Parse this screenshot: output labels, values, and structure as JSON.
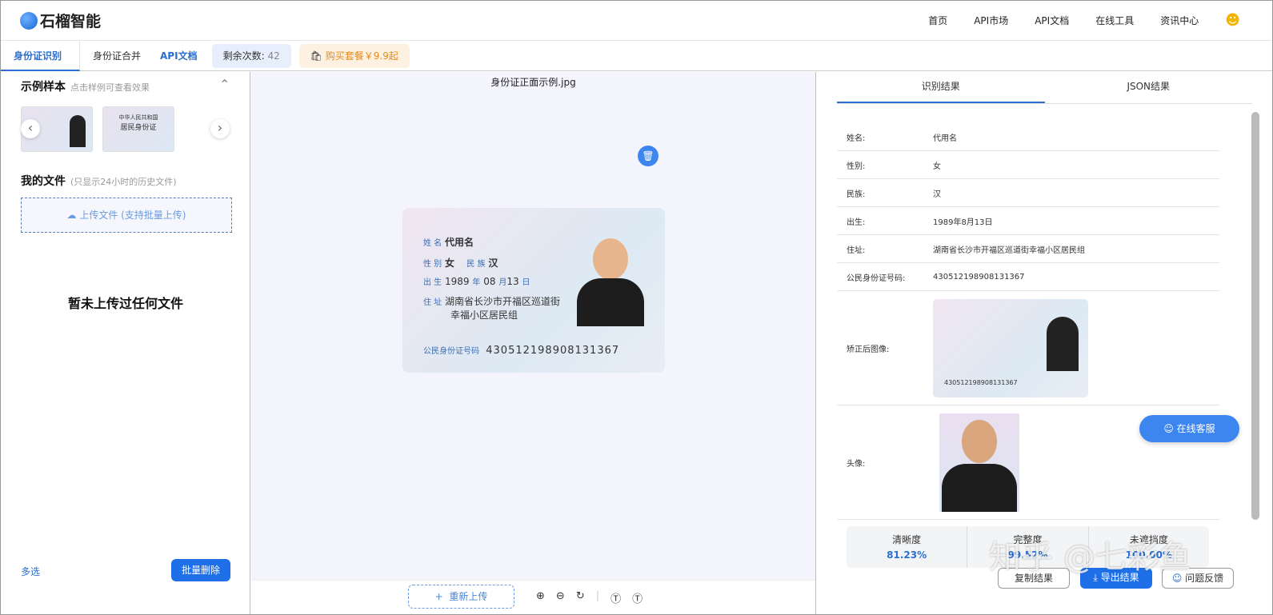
{
  "brand": "石榴智能",
  "nav": [
    "首页",
    "API市场",
    "API文档",
    "在线工具",
    "资讯中心"
  ],
  "tabs": {
    "active": "身份证识别",
    "merge": "身份证合并",
    "api": "API文档",
    "remaining_label": "剩余次数:",
    "remaining": "42",
    "buy": "购买套餐￥9.9起"
  },
  "left": {
    "samples_title": "示例样本",
    "samples_hint": "点击样例可查看效果",
    "files_title": "我的文件",
    "files_hint": "(只显示24小时的历史文件)",
    "upload": "上传文件 (支持批量上传)",
    "empty": "暂未上传过任何文件",
    "multi": "多选",
    "batch_delete": "批量删除",
    "thumb2_line1": "中华人民共和国",
    "thumb2_line2": "居民身份证"
  },
  "center": {
    "filename": "身份证正面示例.jpg",
    "reupload": "重新上传",
    "card": {
      "name_label": "姓 名",
      "name": "代用名",
      "sex_label": "性 别",
      "sex": "女",
      "nation_label": "民 族",
      "nation": "汉",
      "birth_label": "出 生",
      "year": "1989",
      "y": "年",
      "month": "08",
      "m": "月",
      "day": "13",
      "d": "日",
      "addr_label": "住 址",
      "addr1": "湖南省长沙市开福区巡道街",
      "addr2": "幸福小区居民组",
      "id_label": "公民身份证号码",
      "id": "430512198908131367"
    }
  },
  "right": {
    "tab1": "识别结果",
    "tab2": "JSON结果",
    "fields": [
      {
        "k": "姓名:",
        "v": "代用名"
      },
      {
        "k": "性别:",
        "v": "女"
      },
      {
        "k": "民族:",
        "v": "汉"
      },
      {
        "k": "出生:",
        "v": "1989年8月13日"
      },
      {
        "k": "住址:",
        "v": "湖南省长沙市开福区巡道街幸福小区居民组"
      },
      {
        "k": "公民身份证号码:",
        "v": "430512198908131367"
      }
    ],
    "corrected": "矫正后图像:",
    "portrait": "头像:",
    "metrics": [
      {
        "k": "清晰度",
        "v": "81.23%"
      },
      {
        "k": "完整度",
        "v": "99.52%"
      },
      {
        "k": "未遮挡度",
        "v": "100.00%"
      }
    ],
    "copy": "复制结果",
    "export": "导出结果",
    "feedback": "问题反馈",
    "service": "在线客服"
  },
  "watermark": "知乎 @七彩鱼"
}
